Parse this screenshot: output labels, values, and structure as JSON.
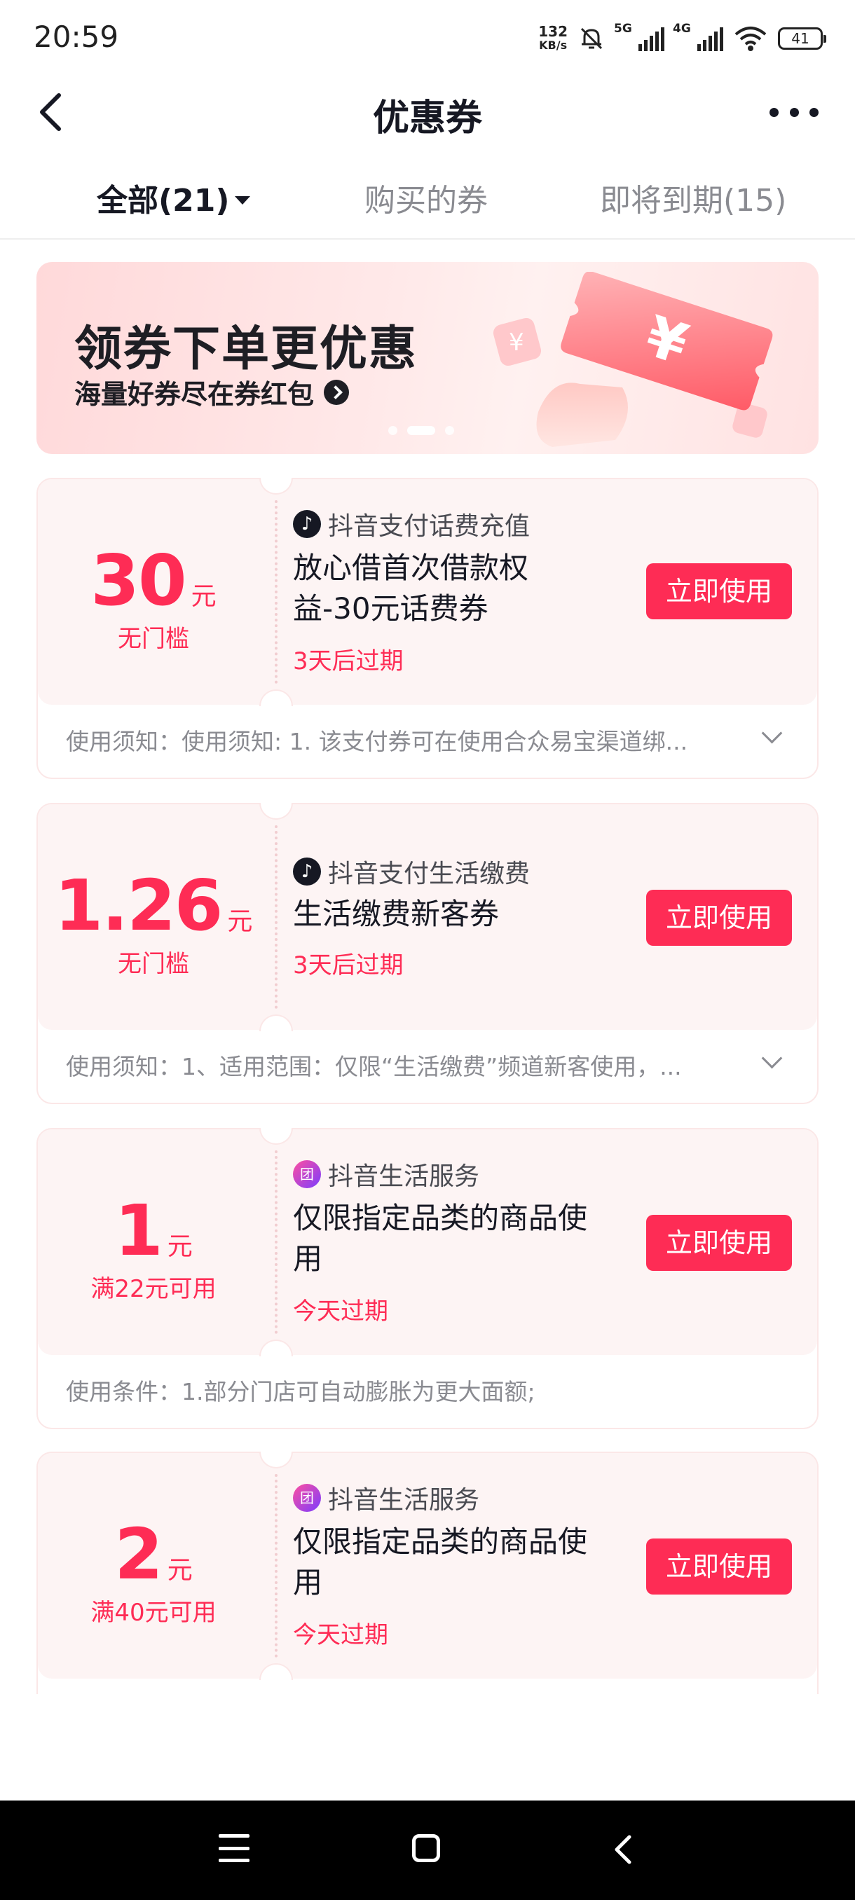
{
  "status_bar": {
    "time": "20:59",
    "net_speed_value": "132",
    "net_speed_unit": "KB/s",
    "signal1_label": "5G",
    "signal2_label": "4G",
    "battery": "41"
  },
  "header": {
    "title": "优惠券"
  },
  "tabs": [
    {
      "label": "全部(21)",
      "active": true
    },
    {
      "label": "购买的券",
      "active": false
    },
    {
      "label": "即将到期(15)",
      "active": false
    }
  ],
  "banner": {
    "title": "领券下单更优惠",
    "subtitle": "海量好券尽在券红包",
    "active_slide": 2,
    "slide_count": 3
  },
  "coupons": [
    {
      "amount": "30",
      "unit": "元",
      "condition": "无门槛",
      "merchant": "抖音支付话费充值",
      "merchant_icon": "douyin-icon",
      "name_line1": "放心借首次借款权",
      "name_line2": "益-30元话费券",
      "expiry": "3天后过期",
      "button": "立即使用",
      "notice": "使用须知：使用须知: 1. 该支付券可在使用合众易宝渠道绑..."
    },
    {
      "amount": "1.26",
      "unit": "元",
      "condition": "无门槛",
      "merchant": "抖音支付生活缴费",
      "merchant_icon": "douyin-icon",
      "name_line1": "生活缴费新客券",
      "name_line2": "",
      "expiry": "3天后过期",
      "button": "立即使用",
      "notice": "使用须知：1、适用范围：仅限“生活缴费”频道新客使用，..."
    },
    {
      "amount": "1",
      "unit": "元",
      "condition": "满22元可用",
      "merchant": "抖音生活服务",
      "merchant_icon": "douyin-life-service-icon",
      "name_line1": "仅限指定品类的商品使",
      "name_line2": "用",
      "expiry": "今天过期",
      "button": "立即使用",
      "notice": "使用条件：1.部分门店可自动膨胀为更大面额;"
    },
    {
      "amount": "2",
      "unit": "元",
      "condition": "满40元可用",
      "merchant": "抖音生活服务",
      "merchant_icon": "douyin-life-service-icon",
      "name_line1": "仅限指定品类的商品使",
      "name_line2": "用",
      "expiry": "今天过期",
      "button": "立即使用",
      "notice": ""
    }
  ],
  "colors": {
    "accent": "#fe2c55",
    "coupon_bg": "#fdf4f4",
    "banner_bg": "#ffe2e2"
  }
}
